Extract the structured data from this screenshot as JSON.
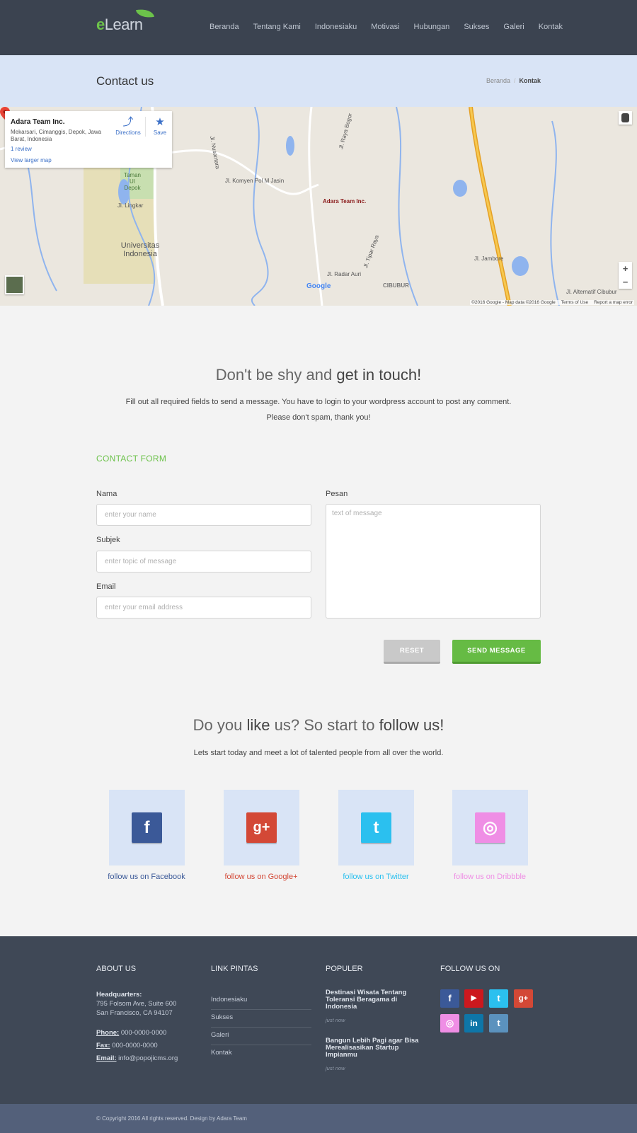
{
  "header": {
    "logo_e": "e",
    "logo_rest": "Learn",
    "nav": [
      "Beranda",
      "Tentang Kami",
      "Indonesiaku",
      "Motivasi",
      "Hubungan",
      "Sukses",
      "Galeri",
      "Kontak"
    ]
  },
  "titleband": {
    "title": "Contact us",
    "breadcrumb_home": "Beranda",
    "breadcrumb_sep": "/",
    "breadcrumb_current": "Kontak"
  },
  "map": {
    "card": {
      "title": "Adara Team Inc.",
      "address": "Mekarsari, Cimanggis, Depok, Jawa Barat, Indonesia",
      "review": "1 review",
      "larger": "View larger map",
      "directions": "Directions",
      "save": "Save"
    },
    "pin_label": "Adara Team Inc.",
    "place_ui": "Universitas Indonesia",
    "labels": [
      "Jl. Komyen Pol M Jasin",
      "Jl. Raya Bogor",
      "Jl. Lingkar",
      "Jl. Nusantara",
      "Jl. Radar Auri",
      "CIBUBUR",
      "Jl. Alternatif Cibubur",
      "Jl. Jambore",
      "Taman UI Depok",
      "Jl. Tipar Raya"
    ],
    "zoom_in": "+",
    "zoom_out": "−",
    "footer_data": "©2016 Google - Map data ©2016 Google",
    "footer_terms": "Terms of Use",
    "footer_report": "Report a map error",
    "google": "Google"
  },
  "intro": {
    "heading_light": "Don't be shy and",
    "heading_strong": "get in touch!",
    "line1": "Fill out all required fields to send a message. You have to login to your wordpress account to post any comment.",
    "line2": "Please don't spam, thank you!"
  },
  "form": {
    "section": "CONTACT FORM",
    "name_label": "Nama",
    "name_placeholder": "enter your name",
    "subject_label": "Subjek",
    "subject_placeholder": "enter topic of message",
    "email_label": "Email",
    "email_placeholder": "enter your email address",
    "message_label": "Pesan",
    "message_placeholder": "text of message",
    "reset": "RESET",
    "send": "SEND MESSAGE"
  },
  "follow": {
    "h_a": "Do you",
    "h_b": "like",
    "h_c": "us? So start to",
    "h_d": "follow us!",
    "sub": "Lets start today and meet a lot of talented people from all over the world.",
    "items": [
      {
        "glyph": "f",
        "label": "follow us on Facebook",
        "color": "#3b5998"
      },
      {
        "glyph": "g+",
        "label": "follow us on Google+",
        "color": "#d34836"
      },
      {
        "glyph": "t",
        "label": "follow us on Twitter",
        "color": "#2bc0ef"
      },
      {
        "glyph": "◎",
        "label": "follow us on Dribbble",
        "color": "#ef8ee5"
      }
    ]
  },
  "footer": {
    "about_head": "ABOUT US",
    "hq_label": "Headquarters:",
    "hq_line1": "795 Folsom Ave, Suite 600",
    "hq_line2": "San Francisco, CA 94107",
    "phone_label": "Phone:",
    "phone": "000-0000-0000",
    "fax_label": "Fax:",
    "fax": "000-0000-0000",
    "email_label": "Email:",
    "email": "info@popojicms.org",
    "links_head": "LINK PINTAS",
    "links": [
      "Indonesiaku",
      "Sukses",
      "Galeri",
      "Kontak"
    ],
    "popular_head": "POPULER",
    "posts": [
      {
        "title": "Destinasi Wisata Tentang Toleransi Beragama di Indonesia",
        "time": "just now"
      },
      {
        "title": "Bangun Lebih Pagi agar Bisa Merealisasikan Startup Impianmu",
        "time": "just now"
      }
    ],
    "follow_head": "FOLLOW US ON",
    "icons": [
      {
        "name": "facebook",
        "glyph": "f",
        "color": "#3b5998"
      },
      {
        "name": "youtube",
        "glyph": "▶",
        "color": "#cc181e"
      },
      {
        "name": "twitter",
        "glyph": "t",
        "color": "#2bc0ef"
      },
      {
        "name": "google-plus",
        "glyph": "g+",
        "color": "#d34836"
      },
      {
        "name": "dribbble",
        "glyph": "◎",
        "color": "#ef8ee5"
      },
      {
        "name": "linkedin",
        "glyph": "in",
        "color": "#0e76a8"
      },
      {
        "name": "tumblr",
        "glyph": "t",
        "color": "#5b92be"
      }
    ],
    "copyright": "© Copyright 2016 All rights reserved. Design by Adara Team"
  }
}
